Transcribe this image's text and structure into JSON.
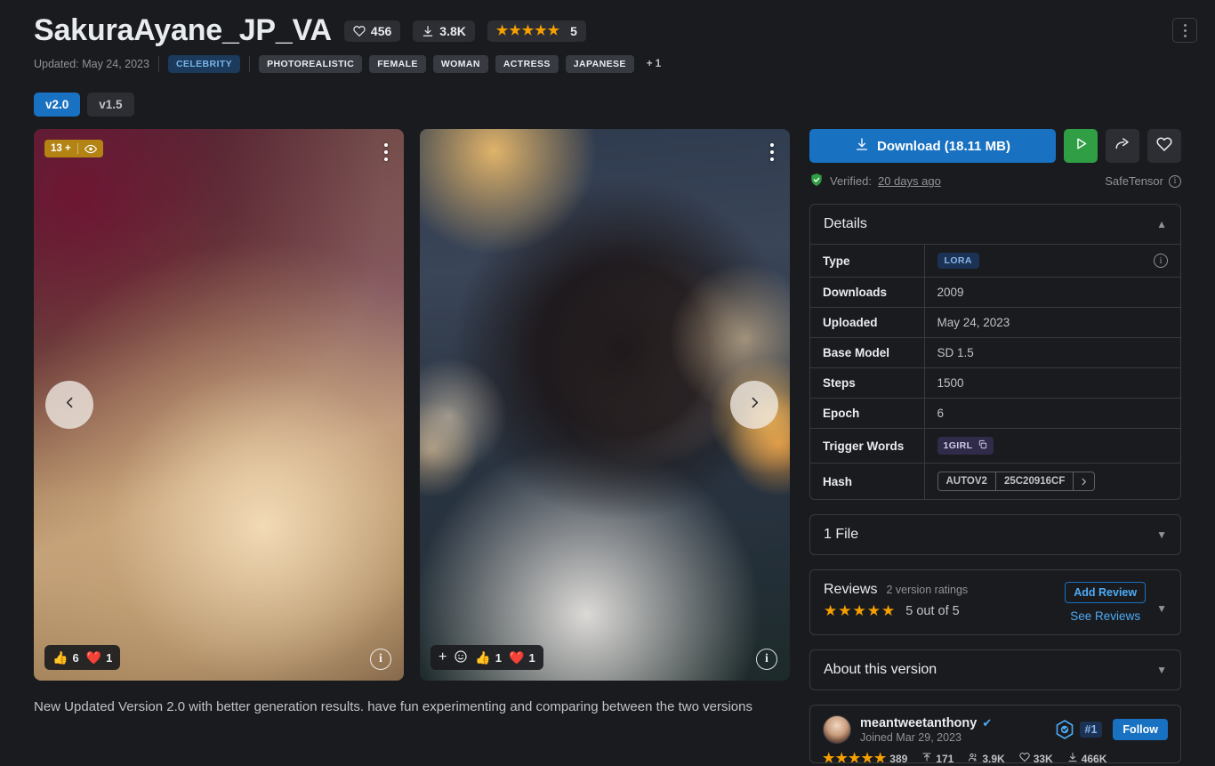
{
  "header": {
    "title": "SakuraAyane_JP_VA",
    "likes": "456",
    "downloads_short": "3.8K",
    "rating_value": "5",
    "updated_label": "Updated: May 24, 2023",
    "tags": [
      "CELEBRITY",
      "PHOTOREALISTIC",
      "FEMALE",
      "WOMAN",
      "ACTRESS",
      "JAPANESE"
    ],
    "tags_more": "+ 1",
    "heart_icon": "heart-icon",
    "download_icon": "download-icon",
    "kebab_icon": "kebab-menu-icon"
  },
  "versions": [
    {
      "label": "v2.0",
      "active": true
    },
    {
      "label": "v1.5",
      "active": false
    }
  ],
  "gallery": {
    "images": [
      {
        "age_rating": "13 +",
        "eye_icon": "eye-icon",
        "kebab_icon": "kebab-menu-icon",
        "info_icon": "info-icon",
        "reactions": [
          {
            "emoji": "👍",
            "count": "6"
          },
          {
            "emoji": "❤️",
            "count": "1"
          }
        ],
        "has_add_reaction": false
      },
      {
        "kebab_icon": "kebab-menu-icon",
        "info_icon": "info-icon",
        "reactions": [
          {
            "emoji": "👍",
            "count": "1"
          },
          {
            "emoji": "❤️",
            "count": "1"
          }
        ],
        "has_add_reaction": true,
        "add_reaction_plus": "+",
        "add_reaction_face": "☺"
      }
    ],
    "prev_label": "‹",
    "next_label": "›"
  },
  "description": "New Updated Version 2.0 with better generation results. have fun experimenting and comparing between the two versions",
  "actions": {
    "download_label": "Download (18.11 MB)",
    "download_icon": "download-icon",
    "play_icon": "play-icon",
    "share_icon": "share-icon",
    "favorite_icon": "heart-outline-icon",
    "accent_blue": "#1971c2",
    "accent_green": "#2f9e44"
  },
  "verification": {
    "shield_icon": "shield-check-icon",
    "label": "Verified:",
    "time": "20 days ago",
    "format": "SafeTensor",
    "info_icon": "info-icon"
  },
  "details": {
    "title": "Details",
    "collapse_icon": "chevron-up-icon",
    "rows": [
      {
        "key": "Type",
        "value": "LORA",
        "kind": "badge",
        "has_info": true
      },
      {
        "key": "Downloads",
        "value": "2009",
        "kind": "text"
      },
      {
        "key": "Uploaded",
        "value": "May 24, 2023",
        "kind": "text"
      },
      {
        "key": "Base Model",
        "value": "SD 1.5",
        "kind": "text"
      },
      {
        "key": "Steps",
        "value": "1500",
        "kind": "text"
      },
      {
        "key": "Epoch",
        "value": "6",
        "kind": "text"
      },
      {
        "key": "Trigger Words",
        "value": "1GIRL",
        "kind": "trigger"
      },
      {
        "key": "Hash",
        "value": "25C20916CF",
        "algo": "AUTOV2",
        "kind": "hash"
      }
    ]
  },
  "files": {
    "title": "1 File",
    "expand_icon": "chevron-down-icon"
  },
  "reviews": {
    "title": "Reviews",
    "subtitle": "2 version ratings",
    "stars": 5,
    "score_text": "5 out of 5",
    "add_review_label": "Add Review",
    "see_reviews_label": "See Reviews",
    "expand_icon": "chevron-down-icon"
  },
  "about": {
    "title": "About this version",
    "expand_icon": "chevron-down-icon"
  },
  "creator": {
    "name": "meantweetanthony",
    "verified_icon": "verified-check-icon",
    "joined": "Joined Mar 29, 2023",
    "rank_icon": "rank-hex-icon",
    "rank": "#1",
    "follow_label": "Follow",
    "stats": [
      {
        "icon": "star-icon",
        "value": "389"
      },
      {
        "icon": "upload-icon",
        "value": "171"
      },
      {
        "icon": "users-icon",
        "value": "3.9K"
      },
      {
        "icon": "heart-icon",
        "value": "33K"
      },
      {
        "icon": "download-icon",
        "value": "466K"
      }
    ]
  }
}
